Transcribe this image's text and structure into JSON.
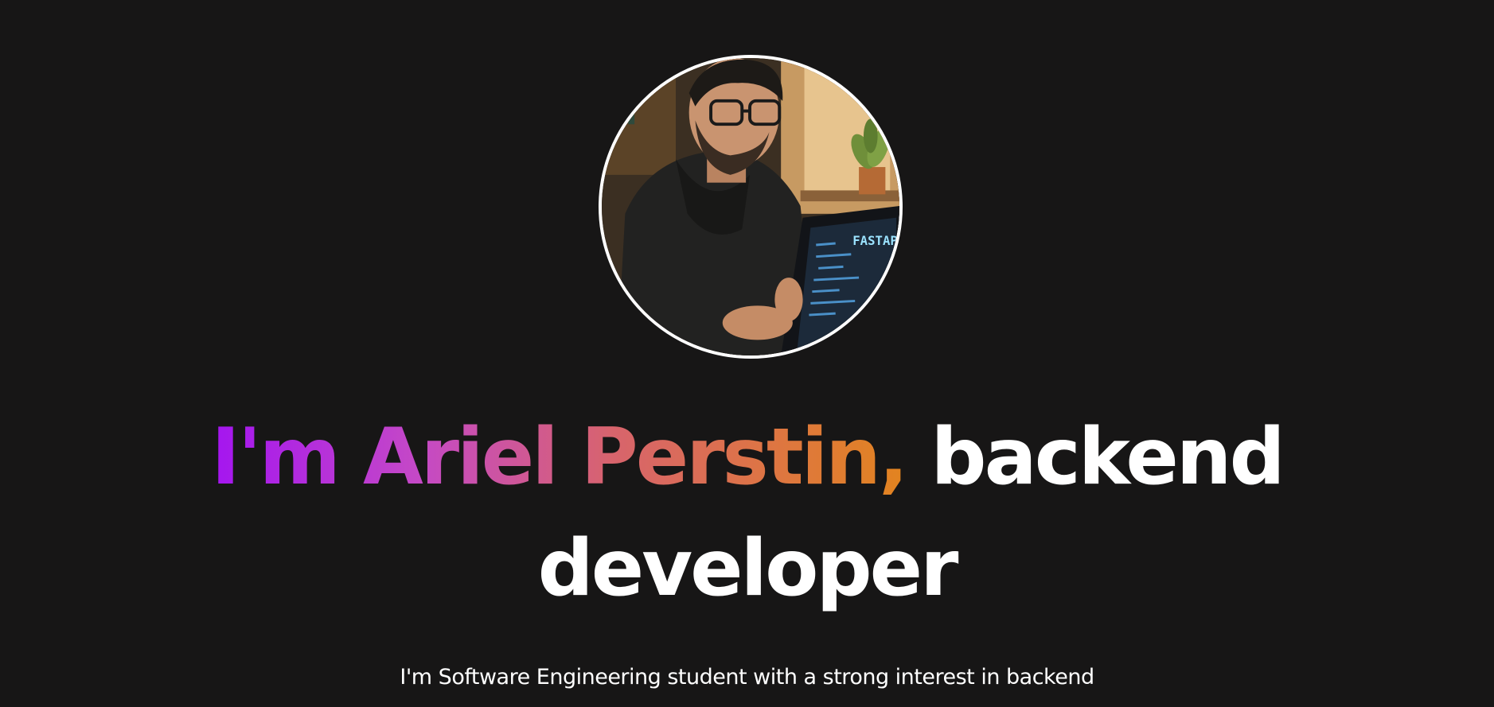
{
  "hero": {
    "avatar_alt": "profile-avatar",
    "avatar_screen_text": "FASTAPI",
    "headline_highlight": "I'm Ariel Perstin,",
    "headline_rest_line1": " backend",
    "headline_rest_line2": "developer",
    "tagline": "I'm Software Engineering student with a strong interest in backend"
  },
  "colors": {
    "background": "#171616",
    "gradient_start": "#a415f0",
    "gradient_mid": "#d8646c",
    "gradient_end": "#e2841f",
    "text": "#ffffff"
  }
}
